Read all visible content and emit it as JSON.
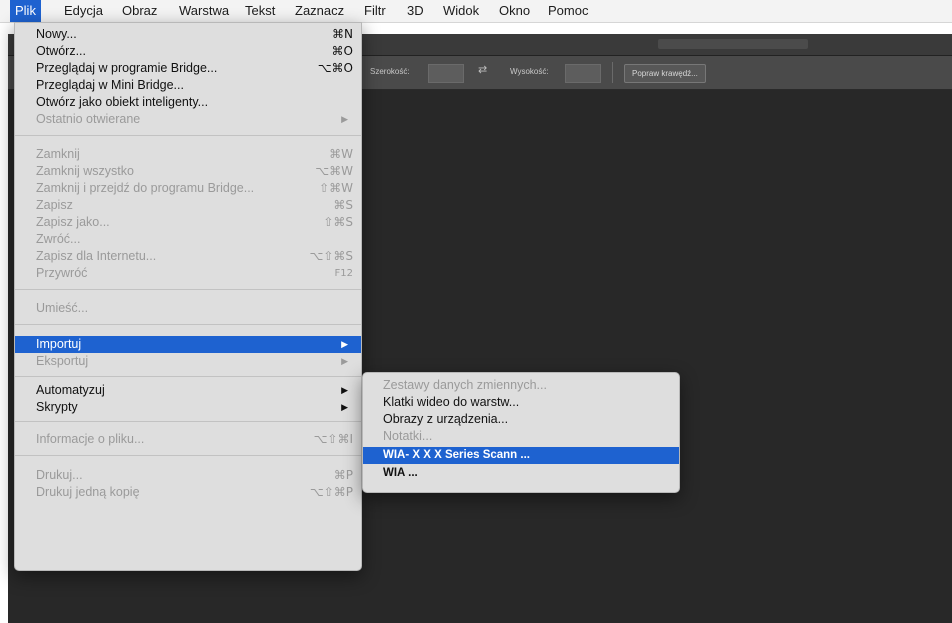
{
  "menubar": {
    "items": [
      {
        "label": "Plik",
        "active": true
      },
      {
        "label": "Edycja"
      },
      {
        "label": "Obraz"
      },
      {
        "label": "Warstwa"
      },
      {
        "label": "Tekst"
      },
      {
        "label": "Zaznacz"
      },
      {
        "label": "Filtr"
      },
      {
        "label": "3D"
      },
      {
        "label": "Widok"
      },
      {
        "label": "Okno"
      },
      {
        "label": "Pomoc"
      }
    ]
  },
  "options": {
    "width_label": "Szerokość:",
    "swap_icon": "swap-arrows-icon",
    "height_label": "Wysokość:",
    "refine_button": "Popraw krawędź..."
  },
  "file_menu": {
    "items": [
      {
        "label": "Nowy...",
        "shortcut": "⌘N",
        "enabled": true
      },
      {
        "label": "Otwórz...",
        "shortcut": "⌘O",
        "enabled": true
      },
      {
        "label": "Przeglądaj w programie Bridge...",
        "shortcut": "⌥⌘O",
        "enabled": true
      },
      {
        "label": "Przeglądaj w Mini Bridge...",
        "shortcut": "",
        "enabled": true
      },
      {
        "label": "Otwórz jako obiekt inteligenty...",
        "shortcut": "",
        "enabled": true
      },
      {
        "label": "Ostatnio otwierane",
        "shortcut": "▶",
        "enabled": false
      },
      {
        "label": "Zamknij",
        "shortcut": "⌘W",
        "enabled": false
      },
      {
        "label": "Zamknij wszystko",
        "shortcut": "⌥⌘W",
        "enabled": false
      },
      {
        "label": "Zamknij i przejdź do programu Bridge...",
        "shortcut": "⇧⌘W",
        "enabled": false
      },
      {
        "label": "Zapisz",
        "shortcut": "⌘S",
        "enabled": false
      },
      {
        "label": "Zapisz jako...",
        "shortcut": "⇧⌘S",
        "enabled": false
      },
      {
        "label": "Zwróć...",
        "shortcut": "",
        "enabled": false
      },
      {
        "label": "Zapisz dla Internetu...",
        "shortcut": "⌥⇧⌘S",
        "enabled": false
      },
      {
        "label": "Przywróć",
        "shortcut": "F12",
        "enabled": false
      },
      {
        "label": "Umieść...",
        "shortcut": "",
        "enabled": false
      },
      {
        "label": "Importuj",
        "shortcut": "▶",
        "enabled": true,
        "highlighted": true
      },
      {
        "label": "Eksportuj",
        "shortcut": "▶",
        "enabled": false
      },
      {
        "label": "Automatyzuj",
        "shortcut": "▶",
        "enabled": true
      },
      {
        "label": "Skrypty",
        "shortcut": "▶",
        "enabled": true
      },
      {
        "label": "Informacje o pliku...",
        "shortcut": "⌥⇧⌘I",
        "enabled": false
      },
      {
        "label": "Drukuj...",
        "shortcut": "⌘P",
        "enabled": false
      },
      {
        "label": "Drukuj jedną kopię",
        "shortcut": "⌥⇧⌘P",
        "enabled": false
      }
    ]
  },
  "import_submenu": {
    "items": [
      {
        "label": "Zestawy danych zmiennych...",
        "enabled": false
      },
      {
        "label": "Klatki wideo do warstw...",
        "enabled": true
      },
      {
        "label": "Obrazy z urządzenia...",
        "enabled": true
      },
      {
        "label": "Notatki...",
        "enabled": false
      },
      {
        "label": "WIA- X X X Series Scann ...",
        "enabled": true,
        "highlighted": true
      },
      {
        "label": "WIA ...",
        "enabled": true
      }
    ]
  },
  "colors": {
    "highlight": "#1e62d0",
    "menu_bg": "#dedede",
    "app_bg": "#282828"
  }
}
